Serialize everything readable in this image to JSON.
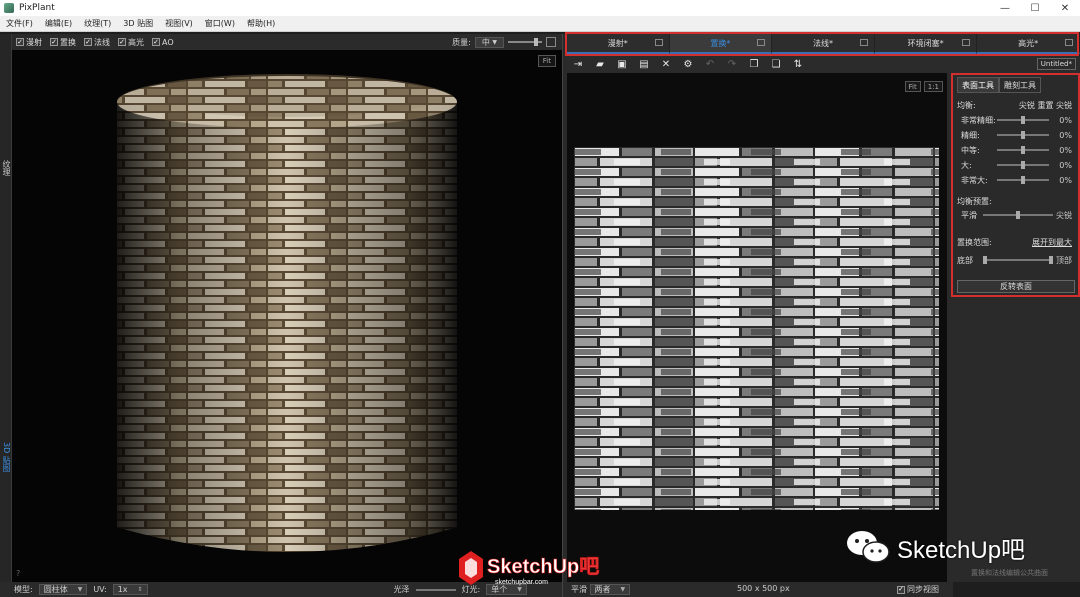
{
  "window": {
    "title": "PixPlant",
    "controls": [
      "—",
      "☐",
      "✕"
    ]
  },
  "menu": [
    "文件(F)",
    "编辑(E)",
    "纹理(T)",
    "3D 贴图",
    "视图(V)",
    "窗口(W)",
    "帮助(H)"
  ],
  "left_toolbar": {
    "checks": [
      {
        "label": "漫射",
        "checked": true
      },
      {
        "label": "置换",
        "checked": true
      },
      {
        "label": "法线",
        "checked": true
      },
      {
        "label": "高光",
        "checked": true
      },
      {
        "label": "AO",
        "checked": true
      }
    ],
    "quality_label": "质量:",
    "quality_value": "中"
  },
  "side_tabs": {
    "texture": "纹理",
    "map3d": "3D 贴图"
  },
  "viewport3d": {
    "fit_label": "Fit",
    "help_mark": "?"
  },
  "bottom_left": {
    "model_label": "模型:",
    "model_value": "圆柱体",
    "uv_label": "UV:",
    "uv_value": "1x",
    "gloss_label": "光泽",
    "light_label": "灯光:",
    "light_value": "单个"
  },
  "right_tabs": [
    {
      "label": "漫射*",
      "active": false
    },
    {
      "label": "置换*",
      "active": true
    },
    {
      "label": "法线*",
      "active": false
    },
    {
      "label": "环境闭塞*",
      "active": false
    },
    {
      "label": "高光*",
      "active": false
    }
  ],
  "editor_toolbar": {
    "doc": "Untitled*"
  },
  "view2d": {
    "fit": "Fit",
    "one": "1:1"
  },
  "bottom_mid": {
    "smooth_label": "平滑",
    "smooth_value": "两者",
    "size": "500 x 500 px",
    "sync_label": "同步视图"
  },
  "tools": {
    "tabs": [
      "表面工具",
      "雕刻工具"
    ],
    "balance_label": "均衡:",
    "balance_options": "尖锐 重置 尖锐",
    "rows": [
      {
        "label": "非常精细:",
        "value": "0%"
      },
      {
        "label": "精细:",
        "value": "0%"
      },
      {
        "label": "中等:",
        "value": "0%"
      },
      {
        "label": "大:",
        "value": "0%"
      },
      {
        "label": "非常大:",
        "value": "0%"
      }
    ],
    "preset_label": "均衡预置:",
    "preset_left": "平滑",
    "preset_right": "尖锐",
    "range_label": "置换范围:",
    "range_link": "展开到最大",
    "range_left": "底部",
    "range_right": "顶部",
    "invert_button": "反转表面",
    "hint": "置换和法线编辑公共曲面"
  },
  "watermark": {
    "brand": "SketchUp吧",
    "url": "sketchupbar.com",
    "wechat": "SketchUp吧"
  },
  "colors": {
    "accent": "#3b8ee0",
    "highlight_box": "#d32f2f",
    "watermark_red": "#e02020"
  }
}
